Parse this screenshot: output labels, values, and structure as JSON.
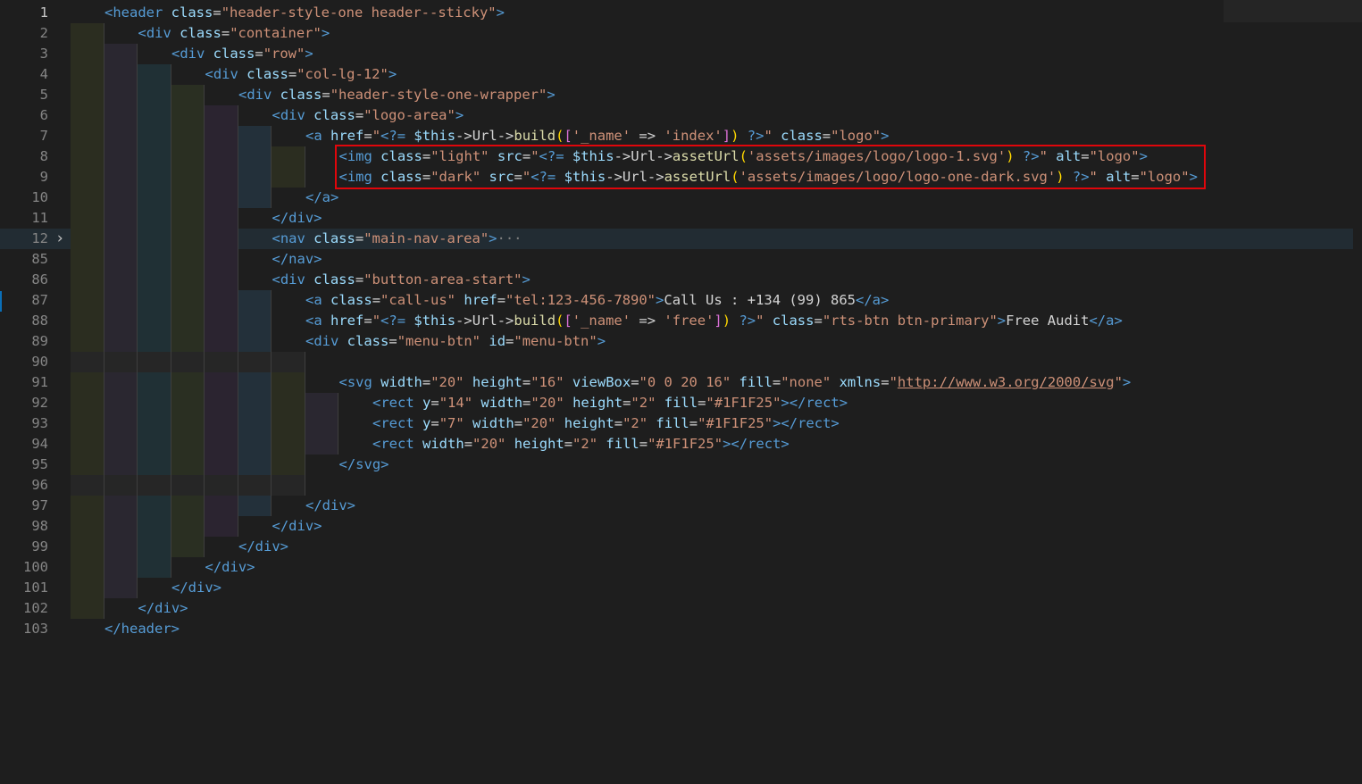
{
  "editor": {
    "lines": [
      {
        "n": "1",
        "indent": 0,
        "active": true,
        "segments": [
          [
            "tag",
            "<header"
          ],
          [
            "txt",
            " "
          ],
          [
            "attr",
            "class"
          ],
          [
            "txt",
            "="
          ],
          [
            "str",
            "\"header-style-one header--sticky\""
          ],
          [
            "tag",
            ">"
          ]
        ]
      },
      {
        "n": "2",
        "indent": 1,
        "segments": [
          [
            "tag",
            "<div"
          ],
          [
            "txt",
            " "
          ],
          [
            "attr",
            "class"
          ],
          [
            "txt",
            "="
          ],
          [
            "str",
            "\"container\""
          ],
          [
            "tag",
            ">"
          ]
        ]
      },
      {
        "n": "3",
        "indent": 2,
        "segments": [
          [
            "tag",
            "<div"
          ],
          [
            "txt",
            " "
          ],
          [
            "attr",
            "class"
          ],
          [
            "txt",
            "="
          ],
          [
            "str",
            "\"row\""
          ],
          [
            "tag",
            ">"
          ]
        ]
      },
      {
        "n": "4",
        "indent": 3,
        "segments": [
          [
            "tag",
            "<div"
          ],
          [
            "txt",
            " "
          ],
          [
            "attr",
            "class"
          ],
          [
            "txt",
            "="
          ],
          [
            "str",
            "\"col-lg-12\""
          ],
          [
            "tag",
            ">"
          ]
        ]
      },
      {
        "n": "5",
        "indent": 4,
        "segments": [
          [
            "tag",
            "<div"
          ],
          [
            "txt",
            " "
          ],
          [
            "attr",
            "class"
          ],
          [
            "txt",
            "="
          ],
          [
            "str",
            "\"header-style-one-wrapper\""
          ],
          [
            "tag",
            ">"
          ]
        ]
      },
      {
        "n": "6",
        "indent": 5,
        "segments": [
          [
            "tag",
            "<div"
          ],
          [
            "txt",
            " "
          ],
          [
            "attr",
            "class"
          ],
          [
            "txt",
            "="
          ],
          [
            "str",
            "\"logo-area\""
          ],
          [
            "tag",
            ">"
          ]
        ]
      },
      {
        "n": "7",
        "indent": 6,
        "segments": [
          [
            "tag",
            "<a"
          ],
          [
            "txt",
            " "
          ],
          [
            "attr",
            "href"
          ],
          [
            "txt",
            "="
          ],
          [
            "str",
            "\""
          ],
          [
            "php",
            "<?="
          ],
          [
            "txt",
            " "
          ],
          [
            "var",
            "$this"
          ],
          [
            "txt",
            "->"
          ],
          [
            "txt",
            "Url"
          ],
          [
            "txt",
            "->"
          ],
          [
            "fn",
            "build"
          ],
          [
            "brk",
            "("
          ],
          [
            "brk2",
            "["
          ],
          [
            "str",
            "'_name'"
          ],
          [
            "txt",
            " => "
          ],
          [
            "str",
            "'index'"
          ],
          [
            "brk2",
            "]"
          ],
          [
            "brk",
            ")"
          ],
          [
            "txt",
            " "
          ],
          [
            "php",
            "?>"
          ],
          [
            "str",
            "\""
          ],
          [
            "txt",
            " "
          ],
          [
            "attr",
            "class"
          ],
          [
            "txt",
            "="
          ],
          [
            "str",
            "\"logo\""
          ],
          [
            "tag",
            ">"
          ]
        ]
      },
      {
        "n": "8",
        "indent": 7,
        "segments": [
          [
            "tag",
            "<img"
          ],
          [
            "txt",
            " "
          ],
          [
            "attr",
            "class"
          ],
          [
            "txt",
            "="
          ],
          [
            "str",
            "\"light\""
          ],
          [
            "txt",
            " "
          ],
          [
            "attr",
            "src"
          ],
          [
            "txt",
            "="
          ],
          [
            "str",
            "\""
          ],
          [
            "php",
            "<?="
          ],
          [
            "txt",
            " "
          ],
          [
            "var",
            "$this"
          ],
          [
            "txt",
            "->"
          ],
          [
            "txt",
            "Url"
          ],
          [
            "txt",
            "->"
          ],
          [
            "fn",
            "assetUrl"
          ],
          [
            "brk",
            "("
          ],
          [
            "str",
            "'assets/images/logo/logo-1.svg'"
          ],
          [
            "brk",
            ")"
          ],
          [
            "txt",
            " "
          ],
          [
            "php",
            "?>"
          ],
          [
            "str",
            "\""
          ],
          [
            "txt",
            " "
          ],
          [
            "attr",
            "alt"
          ],
          [
            "txt",
            "="
          ],
          [
            "str",
            "\"logo\""
          ],
          [
            "tag",
            ">"
          ]
        ]
      },
      {
        "n": "9",
        "indent": 7,
        "segments": [
          [
            "tag",
            "<img"
          ],
          [
            "txt",
            " "
          ],
          [
            "attr",
            "class"
          ],
          [
            "txt",
            "="
          ],
          [
            "str",
            "\"dark\""
          ],
          [
            "txt",
            " "
          ],
          [
            "attr",
            "src"
          ],
          [
            "txt",
            "="
          ],
          [
            "str",
            "\""
          ],
          [
            "php",
            "<?="
          ],
          [
            "txt",
            " "
          ],
          [
            "var",
            "$this"
          ],
          [
            "txt",
            "->"
          ],
          [
            "txt",
            "Url"
          ],
          [
            "txt",
            "->"
          ],
          [
            "fn",
            "assetUrl"
          ],
          [
            "brk",
            "("
          ],
          [
            "str",
            "'assets/images/logo/logo-one-dark.svg'"
          ],
          [
            "brk",
            ")"
          ],
          [
            "txt",
            " "
          ],
          [
            "php",
            "?>"
          ],
          [
            "str",
            "\""
          ],
          [
            "txt",
            " "
          ],
          [
            "attr",
            "alt"
          ],
          [
            "txt",
            "="
          ],
          [
            "str",
            "\"logo\""
          ],
          [
            "tag",
            ">"
          ]
        ]
      },
      {
        "n": "10",
        "indent": 6,
        "segments": [
          [
            "tag",
            "</a>"
          ]
        ]
      },
      {
        "n": "11",
        "indent": 5,
        "segments": [
          [
            "tag",
            "</div>"
          ]
        ]
      },
      {
        "n": "12",
        "indent": 5,
        "fold": true,
        "highlight": true,
        "segments": [
          [
            "tag",
            "<nav"
          ],
          [
            "txt",
            " "
          ],
          [
            "attr",
            "class"
          ],
          [
            "txt",
            "="
          ],
          [
            "str",
            "\"main-nav-area\""
          ],
          [
            "tag",
            ">"
          ],
          [
            "dim",
            "···"
          ]
        ]
      },
      {
        "n": "85",
        "indent": 5,
        "segments": [
          [
            "tag",
            "</nav>"
          ]
        ]
      },
      {
        "n": "86",
        "indent": 5,
        "segments": [
          [
            "tag",
            "<div"
          ],
          [
            "txt",
            " "
          ],
          [
            "attr",
            "class"
          ],
          [
            "txt",
            "="
          ],
          [
            "str",
            "\"button-area-start\""
          ],
          [
            "tag",
            ">"
          ]
        ]
      },
      {
        "n": "87",
        "indent": 6,
        "segments": [
          [
            "tag",
            "<a"
          ],
          [
            "txt",
            " "
          ],
          [
            "attr",
            "class"
          ],
          [
            "txt",
            "="
          ],
          [
            "str",
            "\"call-us\""
          ],
          [
            "txt",
            " "
          ],
          [
            "attr",
            "href"
          ],
          [
            "txt",
            "="
          ],
          [
            "str",
            "\"tel:123-456-7890\""
          ],
          [
            "tag",
            ">"
          ],
          [
            "txt",
            "Call Us : +134 (99) 865"
          ],
          [
            "tag",
            "</a>"
          ]
        ]
      },
      {
        "n": "88",
        "indent": 6,
        "segments": [
          [
            "tag",
            "<a"
          ],
          [
            "txt",
            " "
          ],
          [
            "attr",
            "href"
          ],
          [
            "txt",
            "="
          ],
          [
            "str",
            "\""
          ],
          [
            "php",
            "<?="
          ],
          [
            "txt",
            " "
          ],
          [
            "var",
            "$this"
          ],
          [
            "txt",
            "->"
          ],
          [
            "txt",
            "Url"
          ],
          [
            "txt",
            "->"
          ],
          [
            "fn",
            "build"
          ],
          [
            "brk",
            "("
          ],
          [
            "brk2",
            "["
          ],
          [
            "str",
            "'_name'"
          ],
          [
            "txt",
            " => "
          ],
          [
            "str",
            "'free'"
          ],
          [
            "brk2",
            "]"
          ],
          [
            "brk",
            ")"
          ],
          [
            "txt",
            " "
          ],
          [
            "php",
            "?>"
          ],
          [
            "str",
            "\""
          ],
          [
            "txt",
            " "
          ],
          [
            "attr",
            "class"
          ],
          [
            "txt",
            "="
          ],
          [
            "str",
            "\"rts-btn btn-primary\""
          ],
          [
            "tag",
            ">"
          ],
          [
            "txt",
            "Free Audit"
          ],
          [
            "tag",
            "</a>"
          ]
        ]
      },
      {
        "n": "89",
        "indent": 6,
        "segments": [
          [
            "tag",
            "<div"
          ],
          [
            "txt",
            " "
          ],
          [
            "attr",
            "class"
          ],
          [
            "txt",
            "="
          ],
          [
            "str",
            "\"menu-btn\""
          ],
          [
            "txt",
            " "
          ],
          [
            "attr",
            "id"
          ],
          [
            "txt",
            "="
          ],
          [
            "str",
            "\"menu-btn\""
          ],
          [
            "tag",
            ">"
          ]
        ]
      },
      {
        "n": "90",
        "indent": 0,
        "blank": true,
        "segments": []
      },
      {
        "n": "91",
        "indent": 7,
        "segments": [
          [
            "tag",
            "<svg"
          ],
          [
            "txt",
            " "
          ],
          [
            "attr",
            "width"
          ],
          [
            "txt",
            "="
          ],
          [
            "str",
            "\"20\""
          ],
          [
            "txt",
            " "
          ],
          [
            "attr",
            "height"
          ],
          [
            "txt",
            "="
          ],
          [
            "str",
            "\"16\""
          ],
          [
            "txt",
            " "
          ],
          [
            "attr",
            "viewBox"
          ],
          [
            "txt",
            "="
          ],
          [
            "str",
            "\"0 0 20 16\""
          ],
          [
            "txt",
            " "
          ],
          [
            "attr",
            "fill"
          ],
          [
            "txt",
            "="
          ],
          [
            "str",
            "\"none\""
          ],
          [
            "txt",
            " "
          ],
          [
            "attr",
            "xmlns"
          ],
          [
            "txt",
            "="
          ],
          [
            "str",
            "\""
          ],
          [
            "url",
            "http://www.w3.org/2000/svg"
          ],
          [
            "str",
            "\""
          ],
          [
            "tag",
            ">"
          ]
        ]
      },
      {
        "n": "92",
        "indent": 8,
        "segments": [
          [
            "tag",
            "<rect"
          ],
          [
            "txt",
            " "
          ],
          [
            "attr",
            "y"
          ],
          [
            "txt",
            "="
          ],
          [
            "str",
            "\"14\""
          ],
          [
            "txt",
            " "
          ],
          [
            "attr",
            "width"
          ],
          [
            "txt",
            "="
          ],
          [
            "str",
            "\"20\""
          ],
          [
            "txt",
            " "
          ],
          [
            "attr",
            "height"
          ],
          [
            "txt",
            "="
          ],
          [
            "str",
            "\"2\""
          ],
          [
            "txt",
            " "
          ],
          [
            "attr",
            "fill"
          ],
          [
            "txt",
            "="
          ],
          [
            "str",
            "\"#1F1F25\""
          ],
          [
            "tag",
            "></rect>"
          ]
        ]
      },
      {
        "n": "93",
        "indent": 8,
        "segments": [
          [
            "tag",
            "<rect"
          ],
          [
            "txt",
            " "
          ],
          [
            "attr",
            "y"
          ],
          [
            "txt",
            "="
          ],
          [
            "str",
            "\"7\""
          ],
          [
            "txt",
            " "
          ],
          [
            "attr",
            "width"
          ],
          [
            "txt",
            "="
          ],
          [
            "str",
            "\"20\""
          ],
          [
            "txt",
            " "
          ],
          [
            "attr",
            "height"
          ],
          [
            "txt",
            "="
          ],
          [
            "str",
            "\"2\""
          ],
          [
            "txt",
            " "
          ],
          [
            "attr",
            "fill"
          ],
          [
            "txt",
            "="
          ],
          [
            "str",
            "\"#1F1F25\""
          ],
          [
            "tag",
            "></rect>"
          ]
        ]
      },
      {
        "n": "94",
        "indent": 8,
        "segments": [
          [
            "tag",
            "<rect"
          ],
          [
            "txt",
            " "
          ],
          [
            "attr",
            "width"
          ],
          [
            "txt",
            "="
          ],
          [
            "str",
            "\"20\""
          ],
          [
            "txt",
            " "
          ],
          [
            "attr",
            "height"
          ],
          [
            "txt",
            "="
          ],
          [
            "str",
            "\"2\""
          ],
          [
            "txt",
            " "
          ],
          [
            "attr",
            "fill"
          ],
          [
            "txt",
            "="
          ],
          [
            "str",
            "\"#1F1F25\""
          ],
          [
            "tag",
            "></rect>"
          ]
        ]
      },
      {
        "n": "95",
        "indent": 7,
        "segments": [
          [
            "tag",
            "</svg>"
          ]
        ]
      },
      {
        "n": "96",
        "indent": 0,
        "blank": true,
        "segments": []
      },
      {
        "n": "97",
        "indent": 6,
        "segments": [
          [
            "tag",
            "</div>"
          ]
        ]
      },
      {
        "n": "98",
        "indent": 5,
        "segments": [
          [
            "tag",
            "</div>"
          ]
        ]
      },
      {
        "n": "99",
        "indent": 4,
        "segments": [
          [
            "tag",
            "</div>"
          ]
        ]
      },
      {
        "n": "100",
        "indent": 3,
        "segments": [
          [
            "tag",
            "</div>"
          ]
        ]
      },
      {
        "n": "101",
        "indent": 2,
        "segments": [
          [
            "tag",
            "</div>"
          ]
        ]
      },
      {
        "n": "102",
        "indent": 1,
        "segments": [
          [
            "tag",
            "</div>"
          ]
        ]
      },
      {
        "n": "103",
        "indent": 0,
        "segments": [
          [
            "tag",
            "</header>"
          ]
        ]
      }
    ]
  },
  "colors": {
    "background": "#1e1e1e",
    "selection_box": "#e0060b",
    "tag": "#569cd6",
    "attribute": "#9cdcfe",
    "string": "#ce9178",
    "function": "#dcdcaa",
    "bracket": "#ffd700"
  },
  "icons": {
    "fold": "chevron-right-icon"
  }
}
